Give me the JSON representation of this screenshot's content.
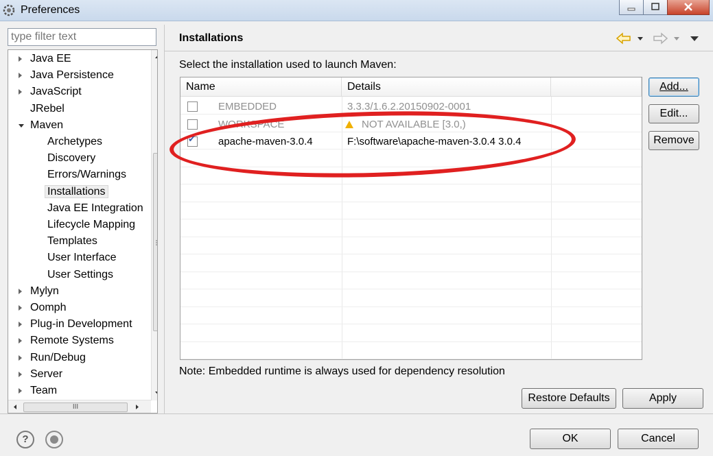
{
  "window": {
    "title": "Preferences"
  },
  "filter": {
    "placeholder": "type filter text"
  },
  "tree": {
    "items": [
      {
        "label": "Java EE",
        "level": 0,
        "expander": "collapsed"
      },
      {
        "label": "Java Persistence",
        "level": 0,
        "expander": "collapsed"
      },
      {
        "label": "JavaScript",
        "level": 0,
        "expander": "collapsed"
      },
      {
        "label": "JRebel",
        "level": 0,
        "expander": "none"
      },
      {
        "label": "Maven",
        "level": 0,
        "expander": "expanded"
      },
      {
        "label": "Archetypes",
        "level": 1
      },
      {
        "label": "Discovery",
        "level": 1
      },
      {
        "label": "Errors/Warnings",
        "level": 1
      },
      {
        "label": "Installations",
        "level": 1,
        "selected": true
      },
      {
        "label": "Java EE Integration",
        "level": 1
      },
      {
        "label": "Lifecycle Mapping",
        "level": 1
      },
      {
        "label": "Templates",
        "level": 1
      },
      {
        "label": "User Interface",
        "level": 1
      },
      {
        "label": "User Settings",
        "level": 1
      },
      {
        "label": "Mylyn",
        "level": 0,
        "expander": "collapsed"
      },
      {
        "label": "Oomph",
        "level": 0,
        "expander": "collapsed"
      },
      {
        "label": "Plug-in Development",
        "level": 0,
        "expander": "collapsed"
      },
      {
        "label": "Remote Systems",
        "level": 0,
        "expander": "collapsed"
      },
      {
        "label": "Run/Debug",
        "level": 0,
        "expander": "collapsed"
      },
      {
        "label": "Server",
        "level": 0,
        "expander": "collapsed"
      },
      {
        "label": "Team",
        "level": 0,
        "expander": "collapsed"
      }
    ],
    "hscroll_grip": "III"
  },
  "page": {
    "title": "Installations",
    "subtitle": "Select the installation used to launch Maven:",
    "note": "Note: Embedded runtime is always used for dependency resolution"
  },
  "table": {
    "headers": [
      "Name",
      "Details"
    ],
    "rows": [
      {
        "checked": false,
        "name": "EMBEDDED",
        "details": "3.3.3/1.6.2.20150902-0001",
        "disabled": true,
        "warning": false
      },
      {
        "checked": false,
        "name": "WORKSPACE",
        "details": "NOT AVAILABLE [3.0,)",
        "disabled": true,
        "warning": true
      },
      {
        "checked": true,
        "name": "apache-maven-3.0.4",
        "details": "F:\\software\\apache-maven-3.0.4 3.0.4",
        "disabled": false,
        "warning": false
      }
    ]
  },
  "buttons": {
    "add": "Add...",
    "edit": "Edit...",
    "remove": "Remove",
    "restore_defaults": "Restore Defaults",
    "apply": "Apply",
    "ok": "OK",
    "cancel": "Cancel"
  },
  "icons": {
    "help": "?",
    "back_arrow_color": "#e8b400",
    "annotation_color": "#e02020"
  }
}
